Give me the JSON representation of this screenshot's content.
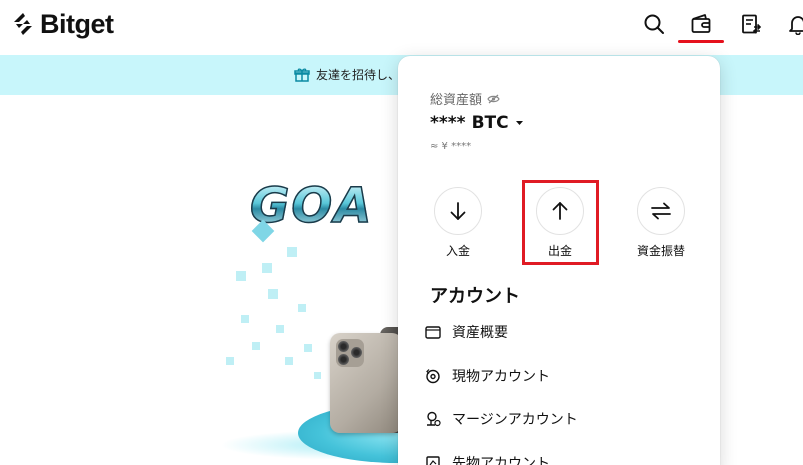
{
  "header": {
    "logo_text": "Bitget",
    "icons": [
      "search-icon",
      "wallet-icon",
      "orders-icon",
      "bell-icon"
    ],
    "active_icon": "wallet-icon",
    "active_color": "#e5101c"
  },
  "banner": {
    "text": "友達を招待し、",
    "background": "#c8f6fb"
  },
  "hero": {
    "headline": "GOA"
  },
  "assets_panel": {
    "total_assets_label": "総資産額",
    "balance_value": "****",
    "balance_currency": "BTC",
    "approx_value": "≈ ¥ ****",
    "actions": [
      {
        "label": "入金",
        "icon": "arrow-down-icon"
      },
      {
        "label": "出金",
        "icon": "arrow-up-icon"
      },
      {
        "label": "資金振替",
        "icon": "transfer-icon"
      }
    ],
    "highlighted_action": "出金",
    "highlight_color": "#e01b24",
    "account_section_title": "アカウント",
    "accounts": [
      {
        "label": "資産概要",
        "icon": "wallet-outline-icon"
      },
      {
        "label": "現物アカウント",
        "icon": "spot-icon"
      },
      {
        "label": "マージンアカウント",
        "icon": "margin-icon"
      },
      {
        "label": "先物アカウント",
        "icon": "futures-icon"
      }
    ]
  }
}
